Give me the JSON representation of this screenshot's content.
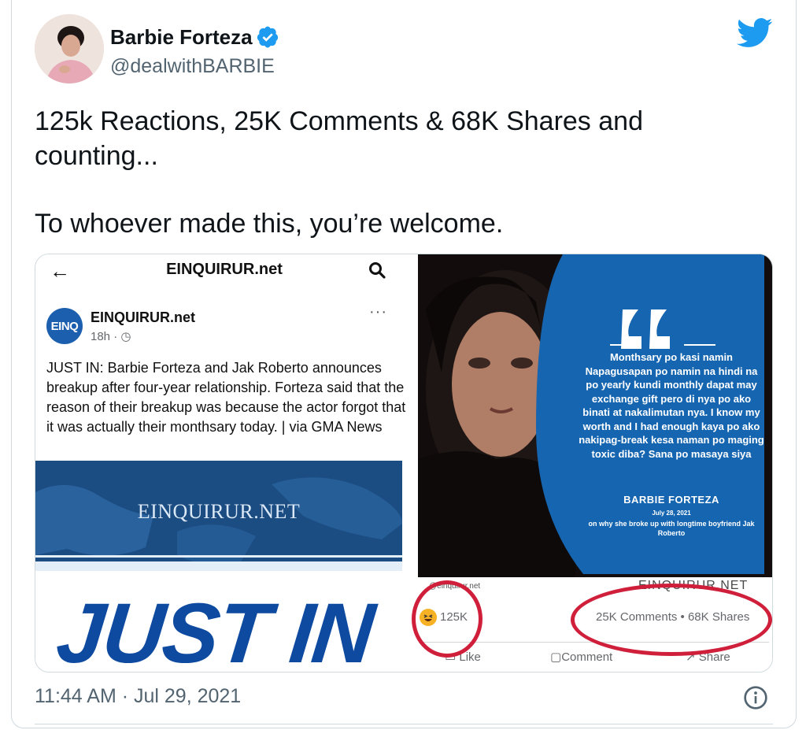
{
  "author": {
    "display_name": "Barbie Forteza",
    "handle": "@dealwithBARBIE",
    "verified": true
  },
  "tweet": {
    "text_line1": "125k Reactions, 25K Comments & 68K Shares and",
    "text_line2": "counting...",
    "text_line3": "To whoever made this, you’re welcome."
  },
  "media": {
    "left": {
      "back_glyph": "←",
      "header_title": "EINQUIRUR.net",
      "page_avatar_text": "EINQ",
      "page_name": "EINQUIRUR.net",
      "post_time": "18h ·",
      "more_glyph": "···",
      "post_body": "JUST IN: Barbie Forteza and Jak Roberto announces breakup after four-year relationship. Forteza said that the reason of their breakup was because the actor forgot that it was actually their monthsary today. | via GMA News",
      "banner_text": "EINQUIRUR.NET",
      "big_headline": "JUST IN"
    },
    "right": {
      "quote_text": "Monthsary po kasi namin Napagusapan po namin na hindi na po yearly kundi monthly dapat may exchange gift pero di nya po ako binati at nakalimutan nya. I know my worth and I had enough kaya po ako nakipag-break kesa naman po maging toxic diba? Sana po masaya siya",
      "quote_name": "BARBIE FORTEZA",
      "quote_date": "July 28, 2021",
      "quote_caption": "on why she broke up with longtime boyfriend Jak Roberto",
      "source_handle": "@einquirur.net",
      "brand_fragment": "EINQUIRUR.NET",
      "reaction_count": "125K",
      "comments_shares": "25K Comments • 68K Shares",
      "like_label": "Like",
      "comment_label": "Comment",
      "share_label": "Share"
    }
  },
  "timestamp": "11:44 AM · Jul 29, 2021",
  "colors": {
    "twitter_blue": "#1d9bf0",
    "annotation_red": "#cf1f3a",
    "quote_panel_blue": "#1565b0",
    "headline_blue": "#0d4aa0"
  },
  "icons": [
    "twitter-logo-icon",
    "verified-badge-icon",
    "back-arrow-icon",
    "search-icon",
    "more-dots-icon",
    "haha-emoji-icon",
    "like-icon",
    "comment-icon",
    "share-icon",
    "info-icon"
  ]
}
